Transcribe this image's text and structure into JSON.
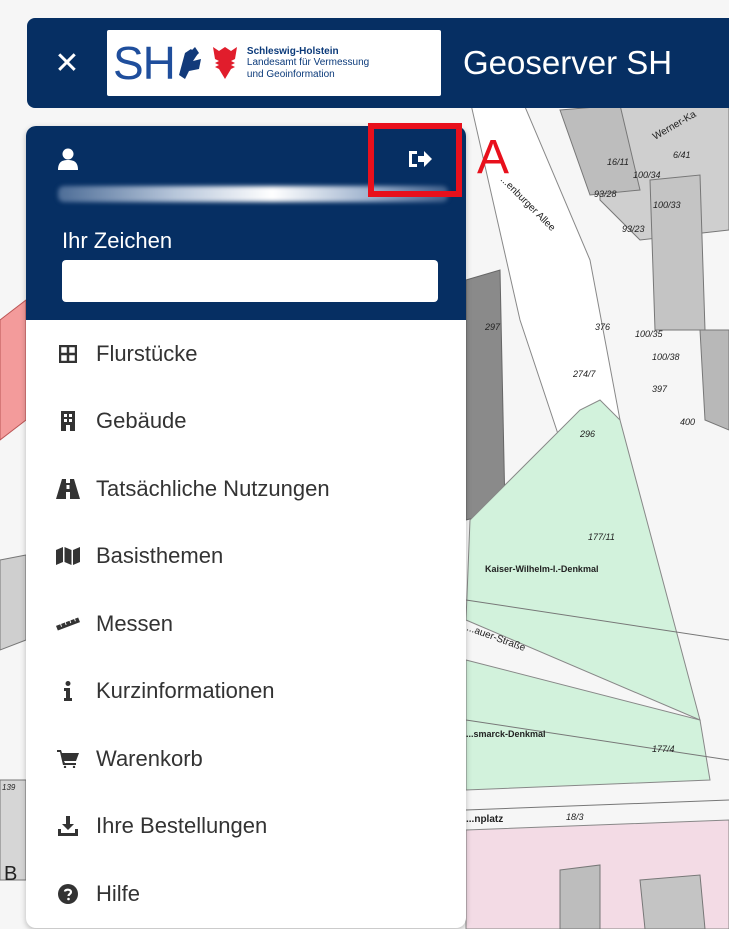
{
  "header": {
    "close_symbol": "✕",
    "logo": {
      "letters": "SH",
      "line1": "Schleswig-Holstein",
      "line2": "Landesamt für Vermessung",
      "line3": "und Geoinformation"
    },
    "title": "Geoserver SH"
  },
  "panel": {
    "user_icon": "user-icon",
    "logout_icon": "sign-out-icon",
    "zeichen_label": "Ihr Zeichen",
    "zeichen_value": "",
    "menu": [
      {
        "label": "Flurstücke",
        "icon": "grid-icon"
      },
      {
        "label": "Gebäude",
        "icon": "building-icon"
      },
      {
        "label": "Tatsächliche Nutzungen",
        "icon": "road-icon"
      },
      {
        "label": "Basisthemen",
        "icon": "map-icon"
      },
      {
        "label": "Messen",
        "icon": "ruler-icon"
      },
      {
        "label": "Kurzinformationen",
        "icon": "info-icon"
      },
      {
        "label": "Warenkorb",
        "icon": "cart-icon"
      },
      {
        "label": "Ihre Bestellungen",
        "icon": "download-icon"
      },
      {
        "label": "Hilfe",
        "icon": "question-icon"
      }
    ]
  },
  "annotation": {
    "letter": "A"
  },
  "map": {
    "labels": {
      "street1": "Werner-Ka",
      "street2": "...enburger Allee",
      "denkmal1": "Kaiser-Wilhelm-I.-Denkmal",
      "street3": "...auer-Straße",
      "denkmal2": "...smarck-Denkmal",
      "platz": "...nplatz",
      "b_letter": "B"
    },
    "parcels": [
      "16/11",
      "100/34",
      "6/41",
      "93/28",
      "100/33",
      "93/23",
      "297",
      "376",
      "100/35",
      "100/38",
      "274/7",
      "397",
      "400",
      "296",
      "177/11",
      "177/4",
      "18/3",
      "139"
    ]
  }
}
